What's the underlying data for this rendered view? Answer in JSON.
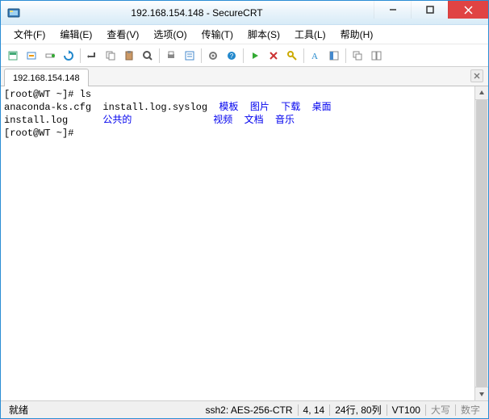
{
  "window": {
    "title": "192.168.154.148 - SecureCRT"
  },
  "menu": {
    "items": [
      {
        "label": "文件(F)"
      },
      {
        "label": "编辑(E)"
      },
      {
        "label": "查看(V)"
      },
      {
        "label": "选项(O)"
      },
      {
        "label": "传输(T)"
      },
      {
        "label": "脚本(S)"
      },
      {
        "label": "工具(L)"
      },
      {
        "label": "帮助(H)"
      }
    ]
  },
  "tabs": {
    "items": [
      {
        "label": "192.168.154.148"
      }
    ]
  },
  "terminal": {
    "lines": [
      {
        "segments": [
          {
            "text": "[root@WT ~]# ls",
            "color": ""
          }
        ]
      },
      {
        "segments": [
          {
            "text": "anaconda-ks.cfg  ",
            "color": ""
          },
          {
            "text": "install.log.syslog  ",
            "color": ""
          },
          {
            "text": "模板  图片  下载  桌面",
            "color": "blue"
          }
        ]
      },
      {
        "segments": [
          {
            "text": "install.log      ",
            "color": ""
          },
          {
            "text": "公共的              视频  文档  音乐",
            "color": "blue"
          }
        ]
      },
      {
        "segments": [
          {
            "text": "[root@WT ~]# ",
            "color": ""
          }
        ]
      }
    ]
  },
  "status": {
    "ready": "就绪",
    "protocol": "ssh2: AES-256-CTR",
    "cursor": "4,  14",
    "size": "24行, 80列",
    "emulation": "VT100",
    "caps": "大写",
    "num": "数字"
  },
  "icons": {
    "toolbar": [
      "new-session",
      "quick-connect",
      "connect-bar",
      "reconnect",
      "sep",
      "enter-key",
      "copy",
      "paste",
      "find",
      "sep",
      "print",
      "properties",
      "sep",
      "settings",
      "help",
      "sep",
      "script-run",
      "script-cancel",
      "key",
      "sep",
      "font",
      "session-mgr",
      "sep",
      "cascade",
      "tile"
    ]
  }
}
